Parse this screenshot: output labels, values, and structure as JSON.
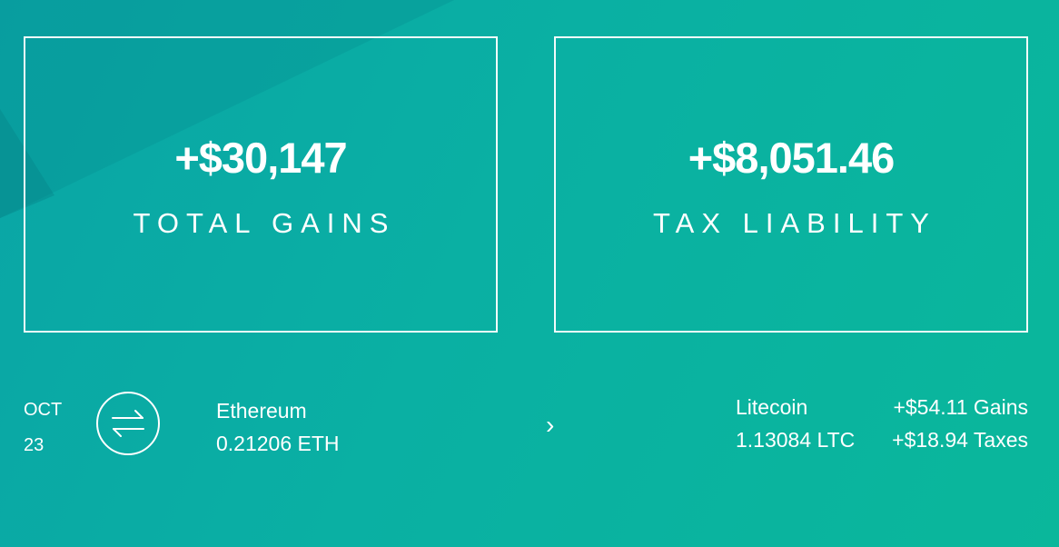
{
  "summary": {
    "total_gains": {
      "amount": "+$30,147",
      "label": "TOTAL GAINS"
    },
    "tax_liability": {
      "amount": "+$8,051.46",
      "label": "TAX LIABILITY"
    }
  },
  "transaction": {
    "date": {
      "month": "OCT",
      "day": "23"
    },
    "icon": "swap-arrows-icon",
    "from": {
      "currency": "Ethereum",
      "amount": "0.21206 ETH"
    },
    "chevron": "›",
    "to": {
      "currency": "Litecoin",
      "amount": "1.13084 LTC"
    },
    "gains": "+$54.11 Gains",
    "taxes": "+$18.94 Taxes"
  },
  "colors": {
    "background_start": "#0aa5a6",
    "background_end": "#0ab79b",
    "foreground": "#ffffff"
  }
}
